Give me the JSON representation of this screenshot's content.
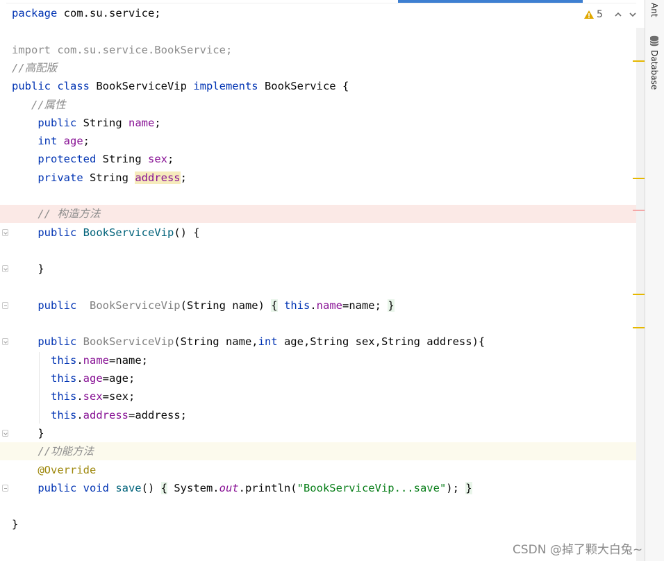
{
  "editor": {
    "lines": [
      {
        "tokens": [
          {
            "t": "package",
            "c": "kw"
          },
          {
            "t": " com.su.service;",
            "c": ""
          }
        ]
      },
      {
        "tokens": []
      },
      {
        "tokens": [
          {
            "t": "import com.su.service.BookService;",
            "c": "muted"
          }
        ]
      },
      {
        "tokens": [
          {
            "t": "//高配版",
            "c": "cmt"
          }
        ]
      },
      {
        "tokens": [
          {
            "t": "public class ",
            "c": "kw"
          },
          {
            "t": "BookServiceVip ",
            "c": ""
          },
          {
            "t": "implements ",
            "c": "kw"
          },
          {
            "t": "BookService {",
            "c": ""
          }
        ]
      },
      {
        "tokens": [
          {
            "t": "   ",
            "c": ""
          },
          {
            "t": "//属性",
            "c": "cmt"
          }
        ]
      },
      {
        "tokens": [
          {
            "t": "    ",
            "c": ""
          },
          {
            "t": "public ",
            "c": "kw"
          },
          {
            "t": "String ",
            "c": ""
          },
          {
            "t": "name",
            "c": "fld"
          },
          {
            "t": ";",
            "c": ""
          }
        ]
      },
      {
        "tokens": [
          {
            "t": "    ",
            "c": ""
          },
          {
            "t": "int ",
            "c": "kw"
          },
          {
            "t": "age",
            "c": "fld"
          },
          {
            "t": ";",
            "c": ""
          }
        ]
      },
      {
        "tokens": [
          {
            "t": "    ",
            "c": ""
          },
          {
            "t": "protected ",
            "c": "kw"
          },
          {
            "t": "String ",
            "c": ""
          },
          {
            "t": "sex",
            "c": "fld"
          },
          {
            "t": ";",
            "c": ""
          }
        ]
      },
      {
        "tokens": [
          {
            "t": "    ",
            "c": ""
          },
          {
            "t": "private ",
            "c": "kw"
          },
          {
            "t": "String ",
            "c": ""
          },
          {
            "t": "address",
            "c": "fld fld-hl"
          },
          {
            "t": ";",
            "c": ""
          }
        ]
      },
      {
        "tokens": []
      },
      {
        "tokens": [
          {
            "t": "    ",
            "c": ""
          },
          {
            "t": "// 构造方法",
            "c": "cmt"
          }
        ],
        "hl": "error"
      },
      {
        "tokens": [
          {
            "t": "    ",
            "c": ""
          },
          {
            "t": "public ",
            "c": "kw"
          },
          {
            "t": "BookServiceVip",
            "c": "mdecl"
          },
          {
            "t": "() {",
            "c": ""
          }
        ],
        "fold": "open"
      },
      {
        "tokens": []
      },
      {
        "tokens": [
          {
            "t": "    }",
            "c": ""
          }
        ],
        "fold": "open"
      },
      {
        "tokens": []
      },
      {
        "tokens": [
          {
            "t": "    ",
            "c": ""
          },
          {
            "t": "public  ",
            "c": "kw"
          },
          {
            "t": "BookServiceVip",
            "c": "unused"
          },
          {
            "t": "(String name) ",
            "c": ""
          },
          {
            "t": "{",
            "c": "brace-hl"
          },
          {
            "t": " ",
            "c": ""
          },
          {
            "t": "this",
            "c": "kw"
          },
          {
            "t": ".",
            "c": ""
          },
          {
            "t": "name",
            "c": "fld"
          },
          {
            "t": "=name; ",
            "c": ""
          },
          {
            "t": "}",
            "c": "brace-hl"
          }
        ],
        "fold": "collapsed"
      },
      {
        "tokens": []
      },
      {
        "tokens": [
          {
            "t": "    ",
            "c": ""
          },
          {
            "t": "public ",
            "c": "kw"
          },
          {
            "t": "BookServiceVip",
            "c": "unused"
          },
          {
            "t": "(String name,",
            "c": ""
          },
          {
            "t": "int ",
            "c": "kw"
          },
          {
            "t": "age,String sex,String address){",
            "c": ""
          }
        ],
        "fold": "open"
      },
      {
        "tokens": [
          {
            "t": "      ",
            "c": ""
          },
          {
            "t": "this",
            "c": "kw"
          },
          {
            "t": ".",
            "c": ""
          },
          {
            "t": "name",
            "c": "fld"
          },
          {
            "t": "=name;",
            "c": ""
          }
        ]
      },
      {
        "tokens": [
          {
            "t": "      ",
            "c": ""
          },
          {
            "t": "this",
            "c": "kw"
          },
          {
            "t": ".",
            "c": ""
          },
          {
            "t": "age",
            "c": "fld"
          },
          {
            "t": "=age;",
            "c": ""
          }
        ]
      },
      {
        "tokens": [
          {
            "t": "      ",
            "c": ""
          },
          {
            "t": "this",
            "c": "kw"
          },
          {
            "t": ".",
            "c": ""
          },
          {
            "t": "sex",
            "c": "fld"
          },
          {
            "t": "=sex;",
            "c": ""
          }
        ]
      },
      {
        "tokens": [
          {
            "t": "      ",
            "c": ""
          },
          {
            "t": "this",
            "c": "kw"
          },
          {
            "t": ".",
            "c": ""
          },
          {
            "t": "address",
            "c": "fld"
          },
          {
            "t": "=address;",
            "c": ""
          }
        ]
      },
      {
        "tokens": [
          {
            "t": "    }",
            "c": ""
          }
        ],
        "fold": "open"
      },
      {
        "tokens": [
          {
            "t": "    ",
            "c": ""
          },
          {
            "t": "//功能方法",
            "c": "cmt"
          }
        ],
        "hl": "current"
      },
      {
        "tokens": [
          {
            "t": "    ",
            "c": ""
          },
          {
            "t": "@Override",
            "c": "ann"
          }
        ]
      },
      {
        "tokens": [
          {
            "t": "    ",
            "c": ""
          },
          {
            "t": "public void ",
            "c": "kw"
          },
          {
            "t": "save",
            "c": "mdecl"
          },
          {
            "t": "() ",
            "c": ""
          },
          {
            "t": "{",
            "c": "brace-hl"
          },
          {
            "t": " System.",
            "c": ""
          },
          {
            "t": "out",
            "c": "static-it"
          },
          {
            "t": ".println(",
            "c": ""
          },
          {
            "t": "\"BookServiceVip...save\"",
            "c": "str"
          },
          {
            "t": "); ",
            "c": ""
          },
          {
            "t": "}",
            "c": "brace-hl"
          }
        ],
        "fold": "collapsed"
      },
      {
        "tokens": []
      },
      {
        "tokens": [
          {
            "t": "}",
            "c": ""
          }
        ]
      }
    ]
  },
  "inspection": {
    "warning_count": "5",
    "warning_icon": "warning-triangle-icon",
    "warning_color": "#e0a800",
    "prev_icon": "chevron-up-icon",
    "next_icon": "chevron-down-icon"
  },
  "markers": {
    "warning_color": "#e6b800",
    "error_color": "#f4a8a8"
  },
  "right_toolbar": {
    "ant_label": "Ant",
    "database_label": "Database",
    "database_icon": "database-icon"
  },
  "watermark": "CSDN @掉了颗大白兔~"
}
